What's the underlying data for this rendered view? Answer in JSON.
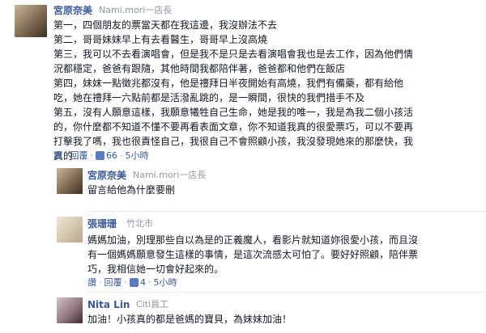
{
  "comments": [
    {
      "name": "宮原奈美",
      "meta": "Nami.mori一店長",
      "lines": [
        "第一，四個朋友的票當天都在我這邊，我沒辦法不去",
        "第二，哥哥妹妹早上有去看醫生，哥哥早上沒高燒",
        "第三，我可以不去看演唱會，但是我不是只是去看演唱會我也是去工作，因為他們情",
        "況都穩定，爸爸有跟隨，其他時間我都陪伴著，爸爸都和他們在飯店",
        "第四，妹妹一點徵兆都沒有，他是禮拜日半夜開始有高燒，我們有備藥，都有給他",
        "吃，她在禮拜一六點前都是活潑亂跳的，是一瞬間，很快的我們措手不及",
        "第五，沒有人願意這樣，我願意犧牲自己生命，她是我的唯一，我是為我二個小孩活",
        "的，你什麼都不知道不懂不要再看表面文章，你不知道我真的很愛票巧，可以不要再",
        "打擊我了嗎，我也很責怪自己，我很自己不會照顧小孩，我沒發現她來的那麼快，我",
        "真的..."
      ],
      "actions": {
        "reply_short": "讚",
        "reply": "回覆",
        "like_count": "66",
        "time": "5小時"
      }
    },
    {
      "name": "宮原奈美",
      "meta": "Nami.mori一店長",
      "lines": [
        "留言給他為什麼要刪"
      ]
    },
    {
      "name": "張珊珊",
      "meta": "竹北市",
      "lines": [
        "媽媽加油，別理那些自以為是的正義魔人，看影片就知道妳很愛小孩，而且沒",
        "有一個媽媽願意發生這樣的事情，是這次流感太可怕了。要好好照顧，陪伴票",
        "巧，我相信她一切會好起來的。"
      ],
      "actions": {
        "reply_short": "讚",
        "reply": "回覆",
        "like_count": "4",
        "time": "5小時"
      }
    },
    {
      "name": "Nita Lin",
      "meta": "Citi員工",
      "lines": [
        "加油！小孩真的都是爸媽的寶貝，為妹妹加油！"
      ]
    }
  ]
}
